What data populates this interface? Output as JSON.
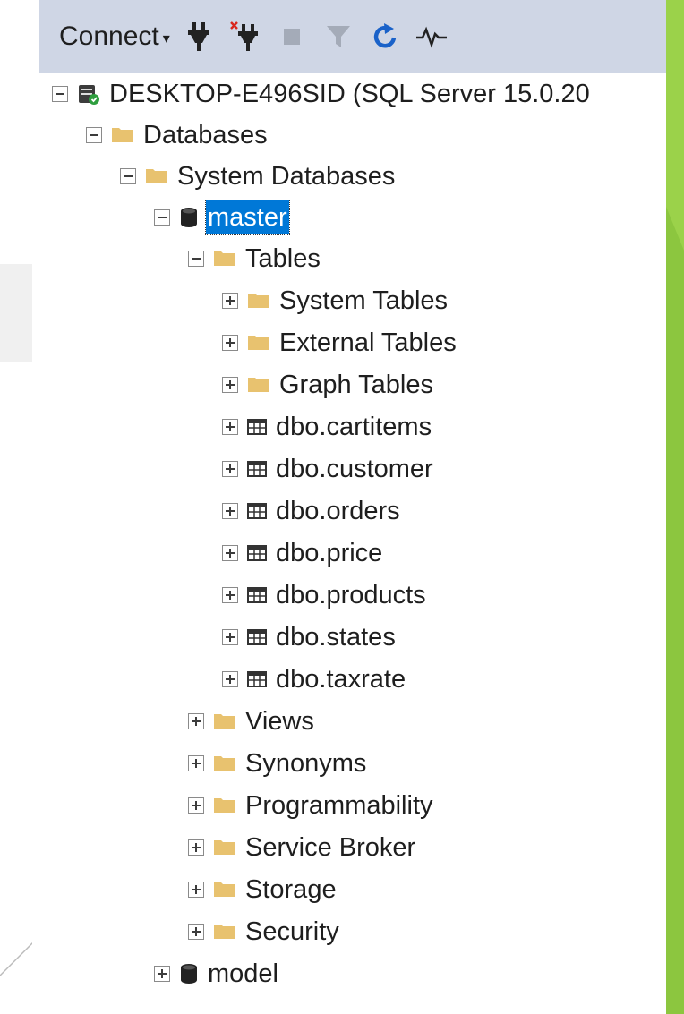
{
  "toolbar": {
    "connect_label": "Connect",
    "connect_caret": "▾",
    "icons": [
      "connect-plug-icon",
      "disconnect-plug-icon",
      "stop-icon",
      "filter-icon",
      "refresh-icon",
      "activity-monitor-icon"
    ]
  },
  "tree": {
    "server": "DESKTOP-E496SID (SQL Server 15.0.20",
    "databases": "Databases",
    "system_databases": "System Databases",
    "master": "master",
    "tables": "Tables",
    "table_folders": [
      "System Tables",
      "External Tables",
      "Graph Tables"
    ],
    "table_items": [
      "dbo.cartitems",
      "dbo.customer",
      "dbo.orders",
      "dbo.price",
      "dbo.products",
      "dbo.states",
      "dbo.taxrate"
    ],
    "master_folders": [
      "Views",
      "Synonyms",
      "Programmability",
      "Service Broker",
      "Storage",
      "Security"
    ],
    "model": "model"
  },
  "colors": {
    "toolbar_bg": "#cfd6e5",
    "selection": "#0078d7",
    "folder": "#e8c26f",
    "slide_green": "#8cc63f"
  }
}
